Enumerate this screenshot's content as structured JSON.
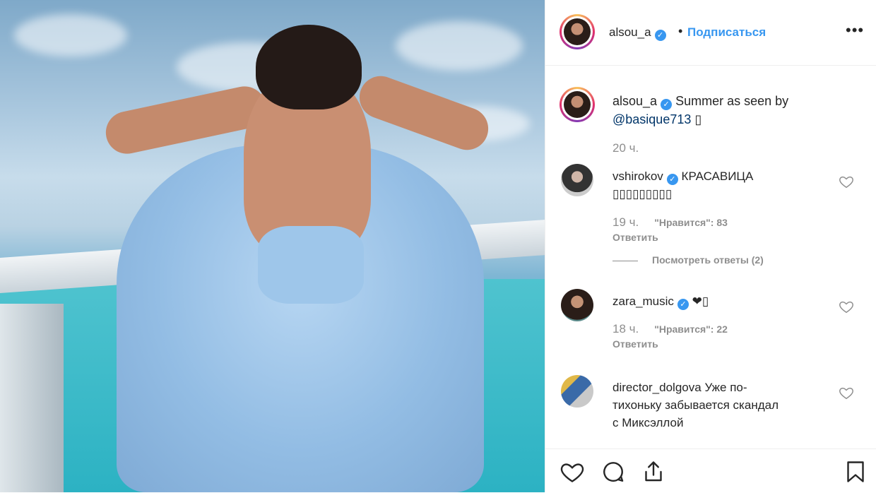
{
  "post": {
    "author": "alsou_a",
    "follow_label": "Подписаться",
    "separator": "•",
    "more_label": "•••",
    "caption_user": "alsou_a",
    "caption_text": "Summer as seen by",
    "caption_mention": "@basique713",
    "caption_emoji": "▯",
    "time": "20 ч."
  },
  "comments": [
    {
      "user": "vshirokov",
      "text": "КРАСАВИЦА",
      "text2": "▯▯▯▯▯▯▯▯▯",
      "time": "19 ч.",
      "likes": "\"Нравится\": 83",
      "reply": "Ответить",
      "view_replies": "Посмотреть ответы (2)"
    },
    {
      "user": "zara_music",
      "text": "❤▯",
      "time": "18 ч.",
      "likes": "\"Нравится\": 22",
      "reply": "Ответить"
    },
    {
      "user": "director_dolgova",
      "text": "Уже по- тихоньку забывается скандал с Миксэллой"
    }
  ],
  "icons": [
    "like-icon",
    "comment-icon",
    "share-icon",
    "bookmark-icon",
    "verified-icon",
    "comment-like-icon"
  ],
  "colors": {
    "accent": "#3897f0",
    "text": "#262626",
    "muted": "#8e8e8e"
  }
}
